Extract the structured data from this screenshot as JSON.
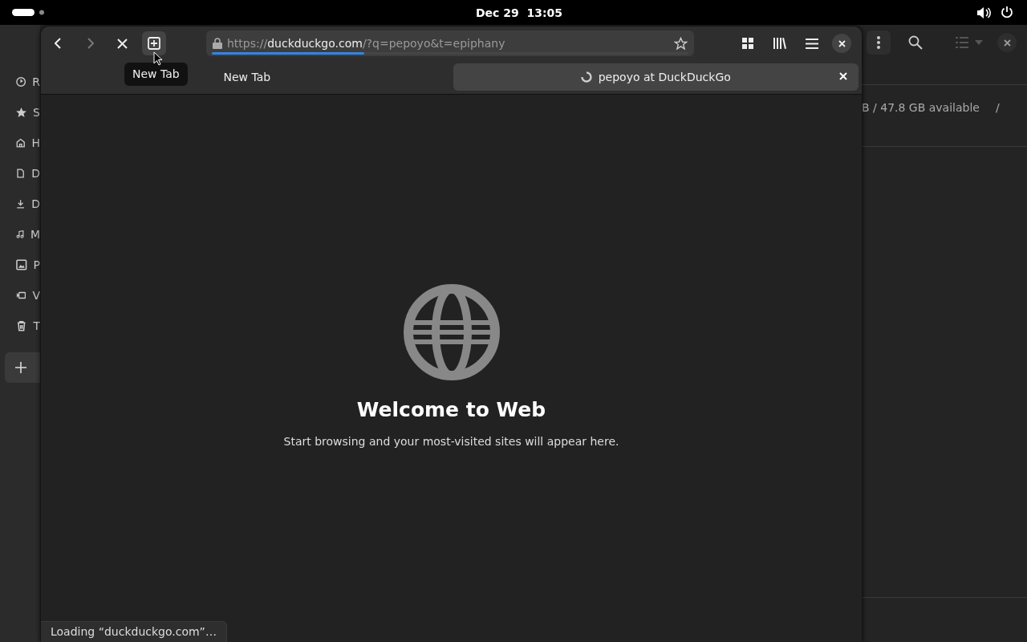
{
  "top_bar": {
    "date": "Dec 29",
    "time": "13:05"
  },
  "file_manager": {
    "sidebar": [
      {
        "kind": "clock",
        "label": "R"
      },
      {
        "kind": "star",
        "label": "S"
      },
      {
        "kind": "home",
        "label": "H"
      },
      {
        "kind": "document",
        "label": "D"
      },
      {
        "kind": "download",
        "label": "D"
      },
      {
        "kind": "music",
        "label": "M"
      },
      {
        "kind": "image",
        "label": "P"
      },
      {
        "kind": "video",
        "label": "V"
      },
      {
        "kind": "trash",
        "label": "T"
      }
    ],
    "storage": "B / 47.8 GB available",
    "path": "/"
  },
  "browser": {
    "url": {
      "scheme": "https://",
      "host": "duckduckgo.com",
      "rest": "/?q=pepoyo&t=epiphany",
      "level": 0.32
    },
    "tooltip": "New Tab",
    "tabs": [
      {
        "title": "New Tab",
        "selected": false,
        "loading": false
      },
      {
        "title": "pepoyo at DuckDuckGo",
        "selected": true,
        "loading": true
      }
    ],
    "welcome_title": "Welcome to Web",
    "welcome_text": "Start browsing and your most-visited sites will appear here.",
    "status": "Loading “duckduckgo.com”…"
  }
}
